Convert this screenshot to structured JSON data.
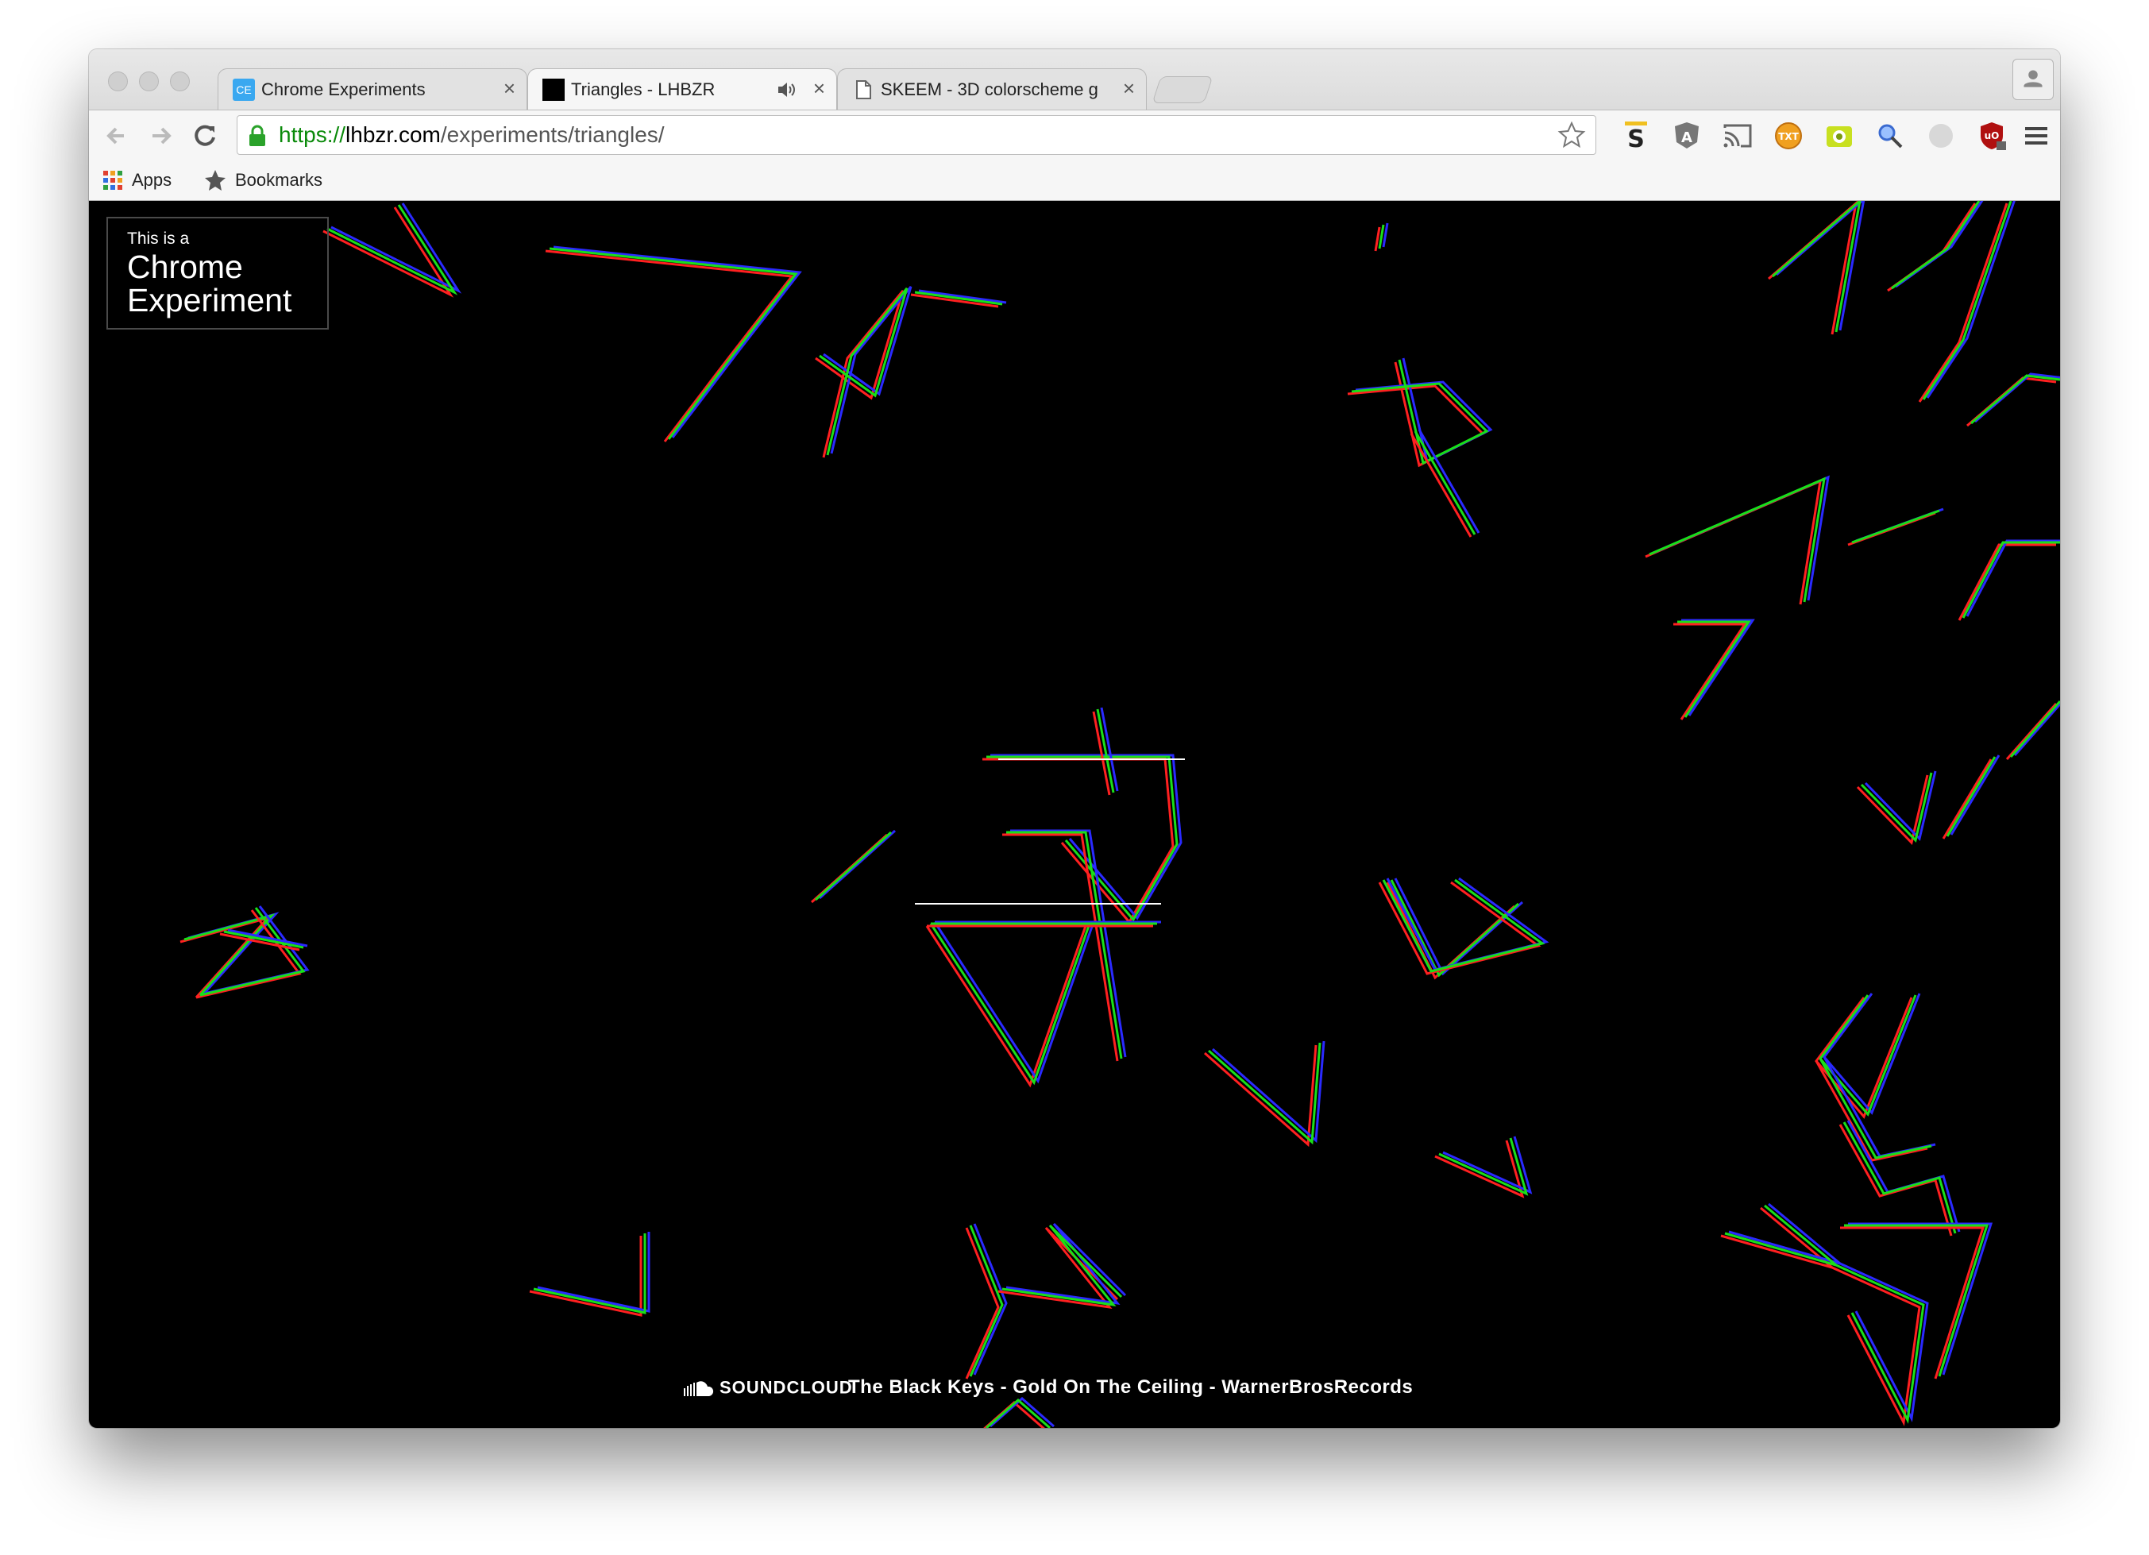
{
  "window": {
    "tabs": [
      {
        "title": "Chrome Experiments",
        "favicon": "CE",
        "active": false
      },
      {
        "title": "Triangles - LHBZR",
        "favicon": "black-square",
        "active": true,
        "audio": true
      },
      {
        "title": "SKEEM - 3D colorscheme g",
        "favicon": "page-icon",
        "active": false
      }
    ]
  },
  "toolbar": {
    "url_scheme": "https://",
    "url_host": "lhbzr.com",
    "url_path": "/experiments/triangles/",
    "extensions": [
      "stylebot-icon",
      "angular-icon",
      "cast-icon",
      "txt-icon",
      "screenshot-icon",
      "inspector-icon",
      "circle-icon",
      "ublock-icon"
    ]
  },
  "bookmarks": {
    "apps": "Apps",
    "bookmarks": "Bookmarks"
  },
  "page": {
    "badge_small": "This is a",
    "badge_line1": "Chrome",
    "badge_line2": "Experiment",
    "soundcloud_label": "SOUNDCLOUD",
    "track": "The Black Keys - Gold On The Ceiling - WarnerBrosRecords"
  },
  "colors": {
    "background": "#000000",
    "stroke_red": "#ff2020",
    "stroke_green": "#19e019",
    "stroke_blue": "#2a2aff"
  }
}
